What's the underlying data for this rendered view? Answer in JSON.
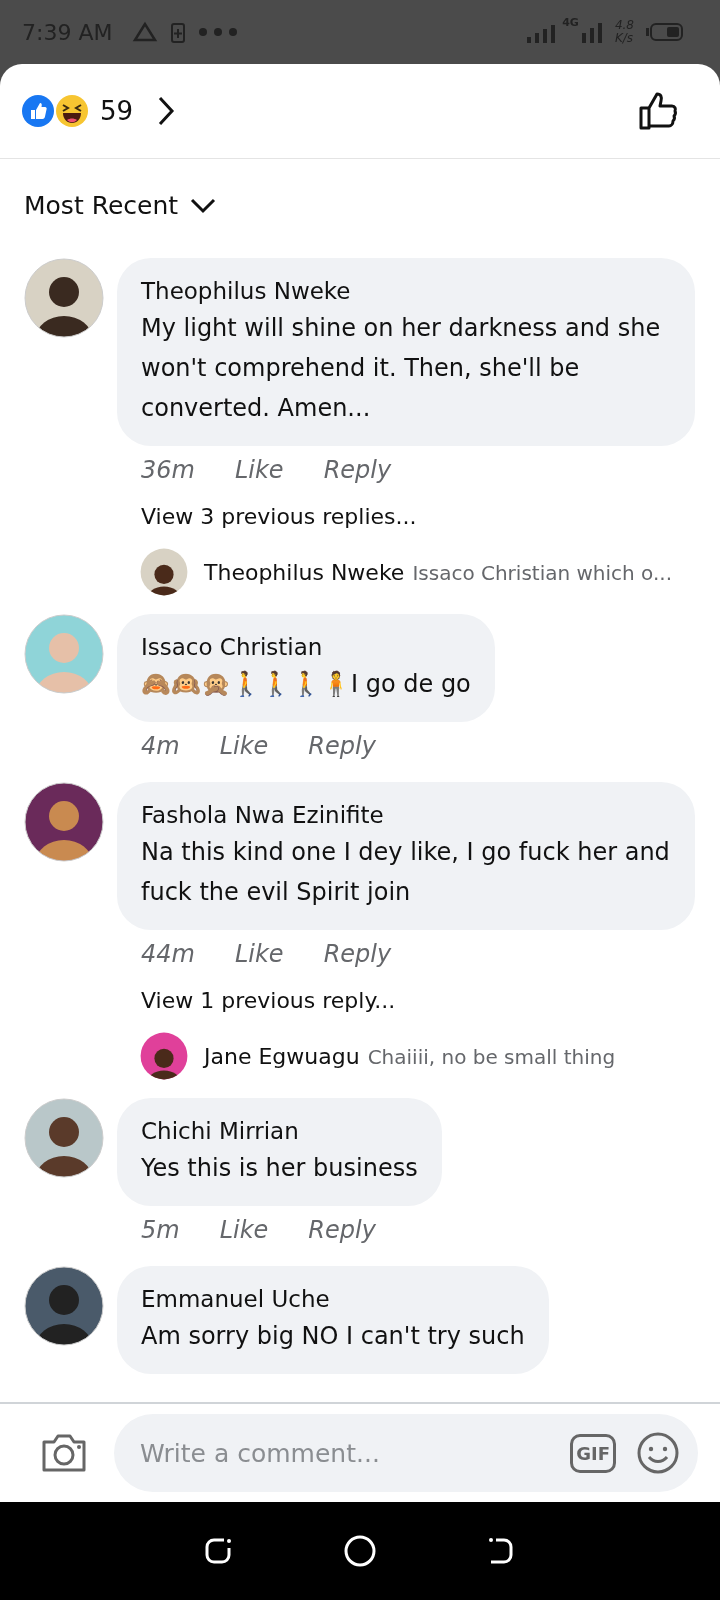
{
  "status_bar": {
    "time": "7:39 AM",
    "network": "4G",
    "speed": "4.8",
    "speed_unit": "K/s"
  },
  "reactions": {
    "count": "59"
  },
  "sort": {
    "label": "Most Recent"
  },
  "comments": [
    {
      "author": "Theophilus Nweke",
      "text": "My light will shine on her darkness and she won't comprehend it. Then, she'll be converted. Amen...",
      "time": "36m",
      "like": "Like",
      "reply": "Reply",
      "view_replies": "View 3 previous replies...",
      "latest_reply": {
        "author": "Theophilus Nweke",
        "text": "Issaco Christian which o..."
      }
    },
    {
      "author": "Issaco Christian",
      "text": "🙈🙉🙊🚶🚶🚶🧍I go de go",
      "time": "4m",
      "like": "Like",
      "reply": "Reply"
    },
    {
      "author": "Fashola Nwa Ezinifite",
      "text": "Na this kind one I dey like, I go fuck her and fuck the evil Spirit join",
      "time": "44m",
      "like": "Like",
      "reply": "Reply",
      "view_replies": "View 1 previous reply...",
      "latest_reply": {
        "author": "Jane Egwuagu",
        "text": "Chaiiii, no be small thing"
      }
    },
    {
      "author": "Chichi Mirrian",
      "text": "Yes this is her business",
      "time": "5m",
      "like": "Like",
      "reply": "Reply"
    },
    {
      "author": "Emmanuel Uche",
      "text": "Am sorry big NO I can't try such"
    }
  ],
  "composer": {
    "placeholder": "Write a comment...",
    "gif": "GIF"
  }
}
